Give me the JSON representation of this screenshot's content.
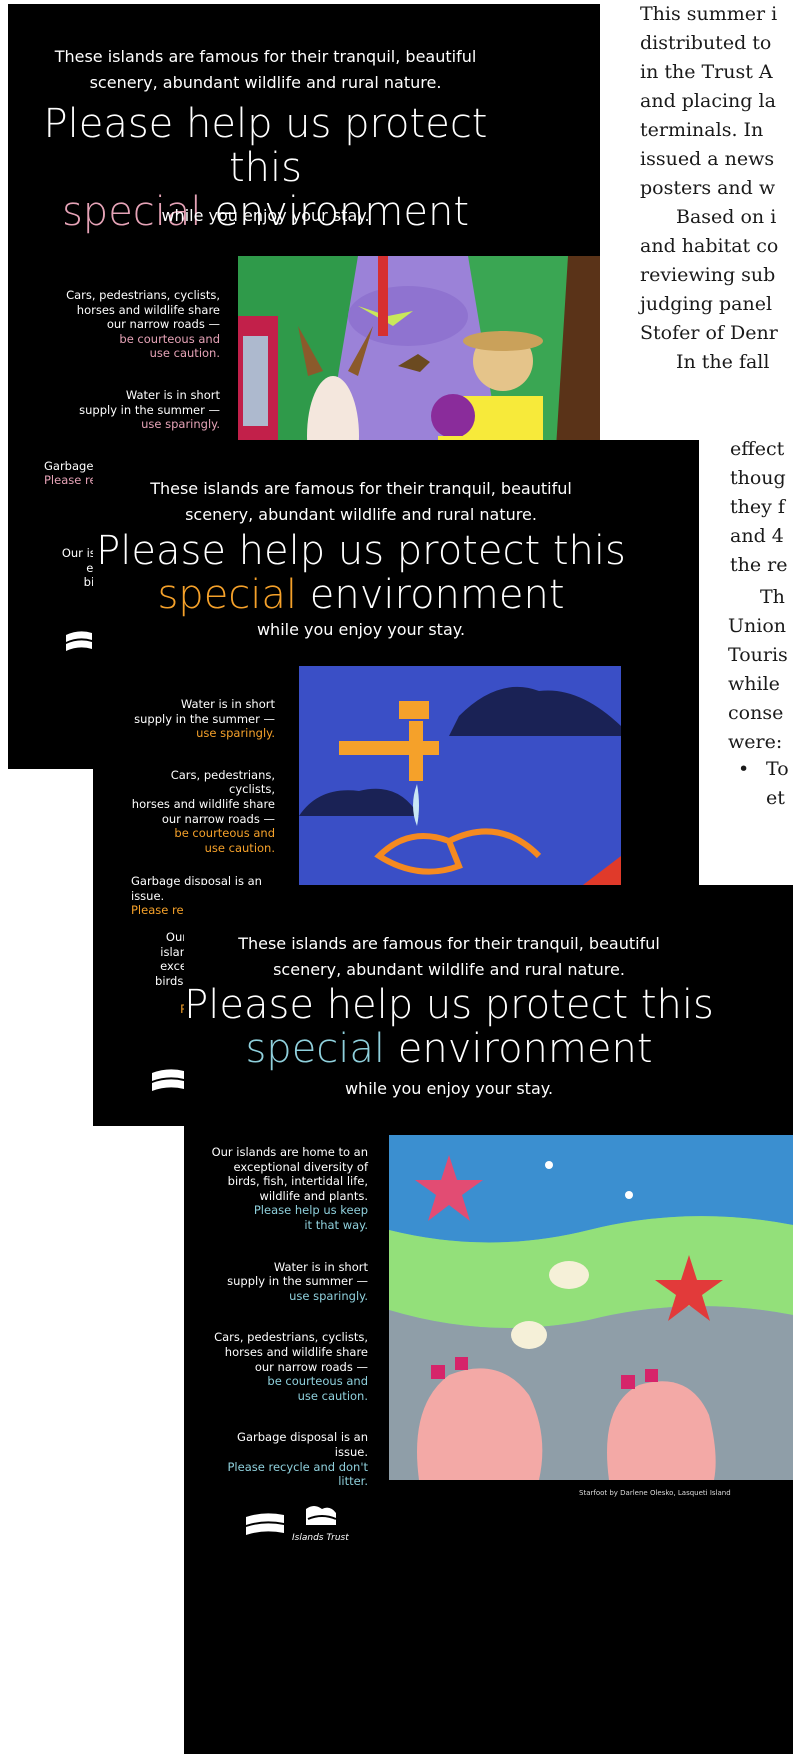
{
  "article": {
    "lines": [
      "This summer i",
      "distributed to",
      "in the Trust A",
      "and placing la",
      "terminals. In",
      "issued a news",
      "posters and w",
      "Based on i",
      "and habitat co",
      "reviewing sub",
      "judging panel",
      "Stofer of Denr",
      "In the fall",
      "effect",
      "thoug",
      "they f",
      "and 4",
      "the re",
      "Th",
      "Union",
      "Touris",
      "while",
      "conse",
      "were:"
    ],
    "bullet": {
      "dot": "•",
      "lines": [
        "To",
        "et"
      ]
    }
  },
  "poster1": {
    "intro": [
      "These islands are famous for their tranquil, beautiful",
      "scenery, abundant wildlife and rural nature."
    ],
    "headline_line1": "Please help us protect this",
    "headline_special": "special",
    "headline_rest": " environment",
    "enjoy": "while you enjoy your stay.",
    "msg_roads": [
      "Cars, pedestrians, cyclists,",
      "horses and wildlife share",
      "our narrow roads —"
    ],
    "msg_roads_hi": [
      "be courteous and",
      "use caution."
    ],
    "msg_water": [
      "Water is in short",
      "supply in the summer —"
    ],
    "msg_water_hi": "use sparingly.",
    "msg_garbage": "Garbage disposal is an issue.",
    "msg_garbage_hi": "Please re",
    "msg_islands": [
      "Our isla",
      "exc",
      "bird"
    ],
    "accent": "#e6a3b7"
  },
  "poster2": {
    "intro": [
      "These islands are famous for their tranquil, beautiful",
      "scenery, abundant wildlife and rural nature."
    ],
    "headline_line1": "Please help us protect this",
    "headline_special": "special",
    "headline_rest": " environment",
    "enjoy": "while you enjoy your stay.",
    "msg_water": [
      "Water is in short",
      "supply in the summer —"
    ],
    "msg_water_hi": "use sparingly.",
    "msg_roads": [
      "Cars, pedestrians, cyclists,",
      "horses and wildlife share",
      "our narrow roads —"
    ],
    "msg_roads_hi": [
      "be courteous and",
      "use caution."
    ],
    "msg_garbage": "Garbage disposal is an issue.",
    "msg_garbage_hi": "Please recy",
    "msg_islands": [
      "Our islan",
      "exce",
      "birds,"
    ],
    "msg_islands_hi": "P",
    "accent": "#f5a12a"
  },
  "poster3": {
    "intro": [
      "These islands are famous for their tranquil, beautiful",
      "scenery, abundant wildlife and rural nature."
    ],
    "headline_line1": "Please help us protect this",
    "headline_special": "special",
    "headline_rest": " environment",
    "enjoy": "while you enjoy your stay.",
    "msg_islands": [
      "Our islands are home to an",
      "exceptional diversity of",
      "birds, fish, intertidal life,",
      "wildlife and plants."
    ],
    "msg_islands_hi": [
      "Please help us keep",
      "it that way."
    ],
    "msg_water": [
      "Water is in short",
      "supply in the summer —"
    ],
    "msg_water_hi": "use sparingly.",
    "msg_roads": [
      "Cars, pedestrians, cyclists,",
      "horses and wildlife share",
      "our narrow roads —"
    ],
    "msg_roads_hi": [
      "be courteous and",
      "use caution."
    ],
    "msg_garbage": "Garbage disposal is an issue.",
    "msg_garbage_hi": "Please recycle and don't litter.",
    "caption": "Starfoot by Darlene Olesko, Lasqueti Island",
    "trust_logo_text": "Islands Trust",
    "accent": "#8fd0dc"
  }
}
